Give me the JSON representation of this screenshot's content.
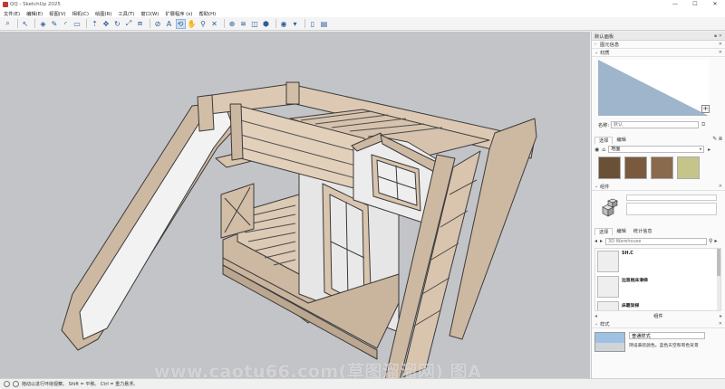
{
  "window": {
    "title": "QQ - SketchUp 2025",
    "minimize": "—",
    "maximize": "☐",
    "close": "✕"
  },
  "menu": [
    "文件(E)",
    "编辑(E)",
    "视图(V)",
    "相机(C)",
    "绘图(R)",
    "工具(T)",
    "窗口(W)",
    "扩展程序 (x)",
    "帮助(H)"
  ],
  "toolbar": {
    "icons": [
      "search-icon",
      "select-icon",
      "eraser-icon",
      "pencil-icon",
      "arc-icon",
      "shape-icon",
      "pushpull-icon",
      "move-icon",
      "rotate-icon",
      "scale-icon",
      "offset-icon",
      "tape-icon",
      "text-icon",
      "orbit-icon",
      "pan-icon",
      "zoom-icon",
      "zoom-extents-icon",
      "component-icon",
      "section-icon",
      "section-fill-icon",
      "solid-icon",
      "shadow-icon",
      "new-file-icon",
      "open-file-icon"
    ]
  },
  "status": {
    "text": "拖动以进行环绕视察。 Shift = 平移。 Ctrl = 重力悬浮。"
  },
  "watermark": "www.caotu66.com(草图溜溜网) 图A",
  "panel": {
    "title": "默认面板",
    "sections": {
      "entity_info": "图元信息",
      "materials": "材质",
      "components": "组件",
      "styles": "样式"
    },
    "materials": {
      "name_label": "名称:",
      "name_placeholder": "默认",
      "tab_select": "选择",
      "tab_edit": "编辑",
      "library": "地面",
      "swatch_colors": [
        "#6b5038",
        "#7a5a3f",
        "#8a6a4c",
        "#c5c58a"
      ]
    },
    "components": {
      "tab_select": "选择",
      "tab_edit": "编辑",
      "tab_stats": "统计信息",
      "search_placeholder": "3D Warehouse",
      "items": [
        "SH.C",
        "边直根床滑梯",
        "床靠架梯"
      ],
      "footer": "组件"
    },
    "styles": {
      "name": "普通样式",
      "description": "持设表装颜色。蓝色天空和有色背景"
    }
  }
}
